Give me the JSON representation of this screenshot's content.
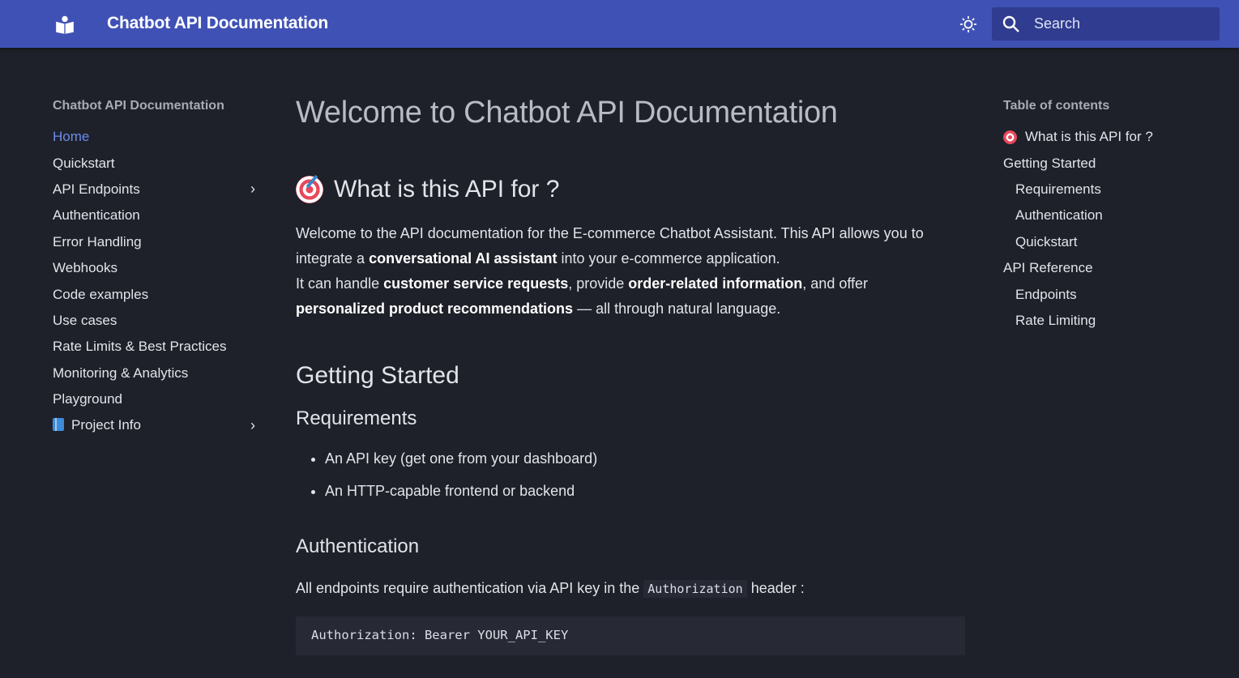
{
  "header": {
    "title": "Chatbot API Documentation",
    "search_placeholder": "Search",
    "accent": "#4051b5"
  },
  "nav": {
    "title": "Chatbot API Documentation",
    "items": [
      {
        "label": "Home",
        "active": true
      },
      {
        "label": "Quickstart"
      },
      {
        "label": "API Endpoints",
        "expandable": true
      },
      {
        "label": "Authentication"
      },
      {
        "label": "Error Handling"
      },
      {
        "label": "Webhooks"
      },
      {
        "label": "Code examples"
      },
      {
        "label": "Use cases"
      },
      {
        "label": "Rate Limits & Best Practices"
      },
      {
        "label": "Monitoring & Analytics"
      },
      {
        "label": "Playground"
      },
      {
        "label": "Project Info",
        "icon": "blue-book-icon",
        "expandable": true
      }
    ]
  },
  "main": {
    "h1": "Welcome to Chatbot API Documentation",
    "what_heading": "What is this API for ?",
    "intro": {
      "p1a": "Welcome to the API documentation for the E-commerce Chatbot Assistant. This API allows you to integrate a ",
      "p1b": "conversational AI assistant",
      "p1c": " into your e-commerce application.",
      "p2a": "It can handle ",
      "p2b": "customer service requests",
      "p2c": ", provide ",
      "p2d": "order-related information",
      "p2e": ", and offer ",
      "p2f": "personalized product recommendations",
      "p2g": " — all through natural language."
    },
    "getting_started": "Getting Started",
    "requirements": "Requirements",
    "req_items": [
      "An API key (get one from your dashboard)",
      "An HTTP-capable frontend or backend"
    ],
    "auth_heading": "Authentication",
    "auth_text_a": "All endpoints require authentication via API key in the ",
    "auth_code": "Authorization",
    "auth_text_b": " header :",
    "code_block": "Authorization: Bearer YOUR_API_KEY"
  },
  "toc": {
    "title": "Table of contents",
    "items": [
      {
        "label": "What is this API for ?",
        "icon": "target-icon"
      },
      {
        "label": "Getting Started"
      },
      {
        "label": "Requirements",
        "sub": true
      },
      {
        "label": "Authentication",
        "sub": true
      },
      {
        "label": "Quickstart",
        "sub": true
      },
      {
        "label": "API Reference"
      },
      {
        "label": "Endpoints",
        "sub": true
      },
      {
        "label": "Rate Limiting",
        "sub": true
      }
    ]
  }
}
